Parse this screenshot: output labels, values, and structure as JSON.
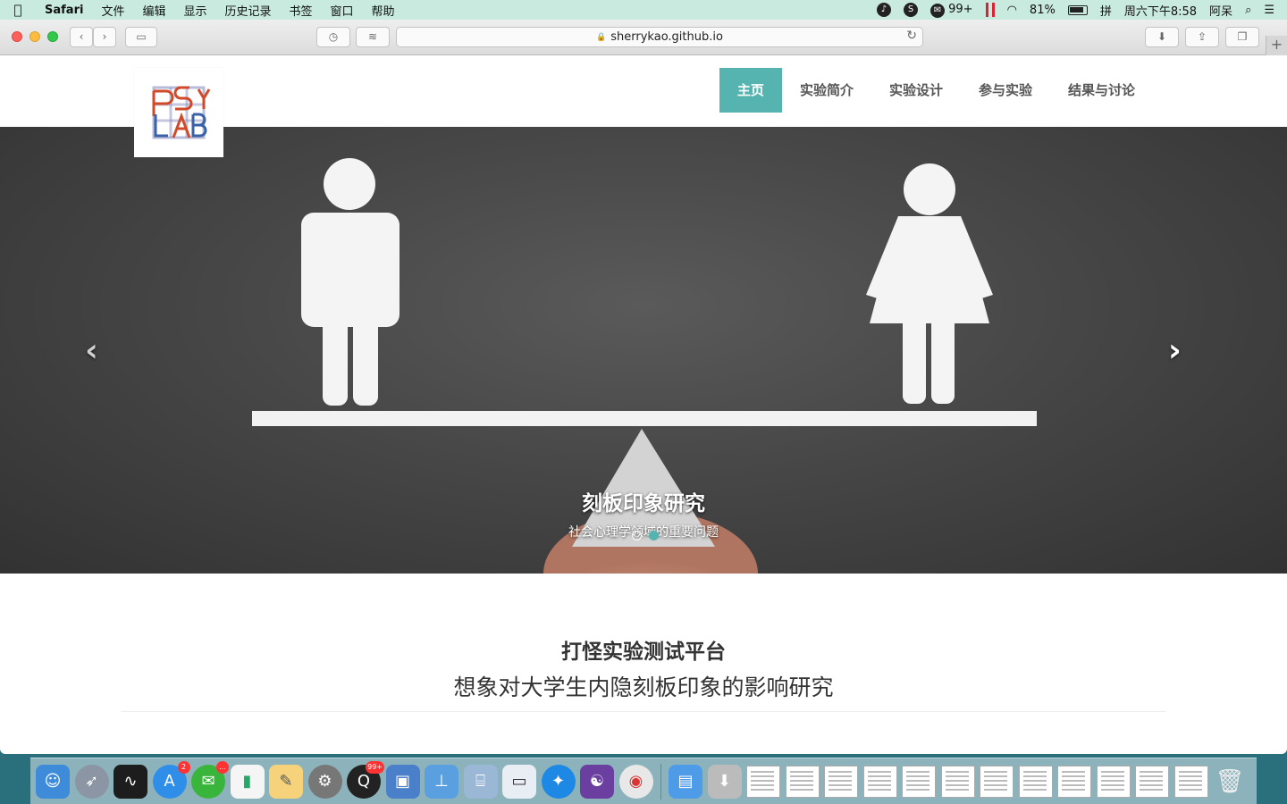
{
  "menubar": {
    "app_name": "Safari",
    "items": [
      "文件",
      "编辑",
      "显示",
      "历史记录",
      "书签",
      "窗口",
      "帮助"
    ],
    "wechat_count": "99+",
    "battery": "81%",
    "input_method": "拼",
    "clock": "周六下午8:58",
    "user": "阿呆"
  },
  "browser": {
    "url": "sherrykao.github.io",
    "new_tab": "+"
  },
  "site": {
    "nav": [
      "主页",
      "实验简介",
      "实验设计",
      "参与实验",
      "结果与讨论"
    ],
    "logo_text": "PSY LAB",
    "carousel": {
      "title": "刻板印象研究",
      "subtitle": "社会心理学领域的重要问题",
      "prev": "‹",
      "next": "›"
    },
    "intro": {
      "line1": "打怪实验测试平台",
      "line2": "想象对大学生内隐刻板印象的影响研究"
    }
  },
  "dock": {
    "app_store_badge": "2",
    "wechat_badge": "...",
    "qq_badge": "99+"
  },
  "colors": {
    "accent": "#55b4b0",
    "menubar": "#c9ebdf"
  }
}
